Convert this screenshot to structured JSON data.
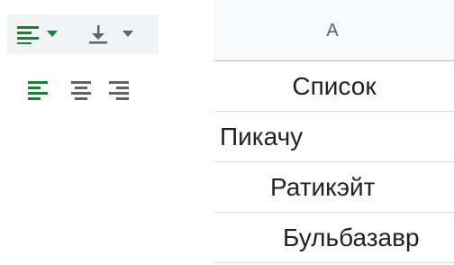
{
  "toolbar": {
    "horizontal_align": {
      "icon": "align-left-icon",
      "dropdown_icon": "caret-down-icon",
      "accent": "#188038"
    },
    "vertical_align": {
      "icon": "align-bottom-icon",
      "dropdown_icon": "caret-down-icon",
      "color": "#5f6368"
    }
  },
  "align_menu": {
    "options": [
      {
        "icon": "align-left-icon",
        "selected": true
      },
      {
        "icon": "align-center-icon",
        "selected": false
      },
      {
        "icon": "align-right-icon",
        "selected": false
      }
    ]
  },
  "sheet": {
    "column_header": "A",
    "rows": [
      {
        "value": "Список",
        "align": "center"
      },
      {
        "value": "Пикачу",
        "align": "left"
      },
      {
        "value": "Ратикэйт",
        "align": "center"
      },
      {
        "value": "Бульбазавр",
        "align": "center"
      }
    ]
  },
  "colors": {
    "accent_green": "#188038",
    "icon_gray": "#5f6368",
    "toolbar_bg": "#f1f3f4",
    "header_bg": "#f8f9fa",
    "grid_line": "#d9d9d9"
  }
}
